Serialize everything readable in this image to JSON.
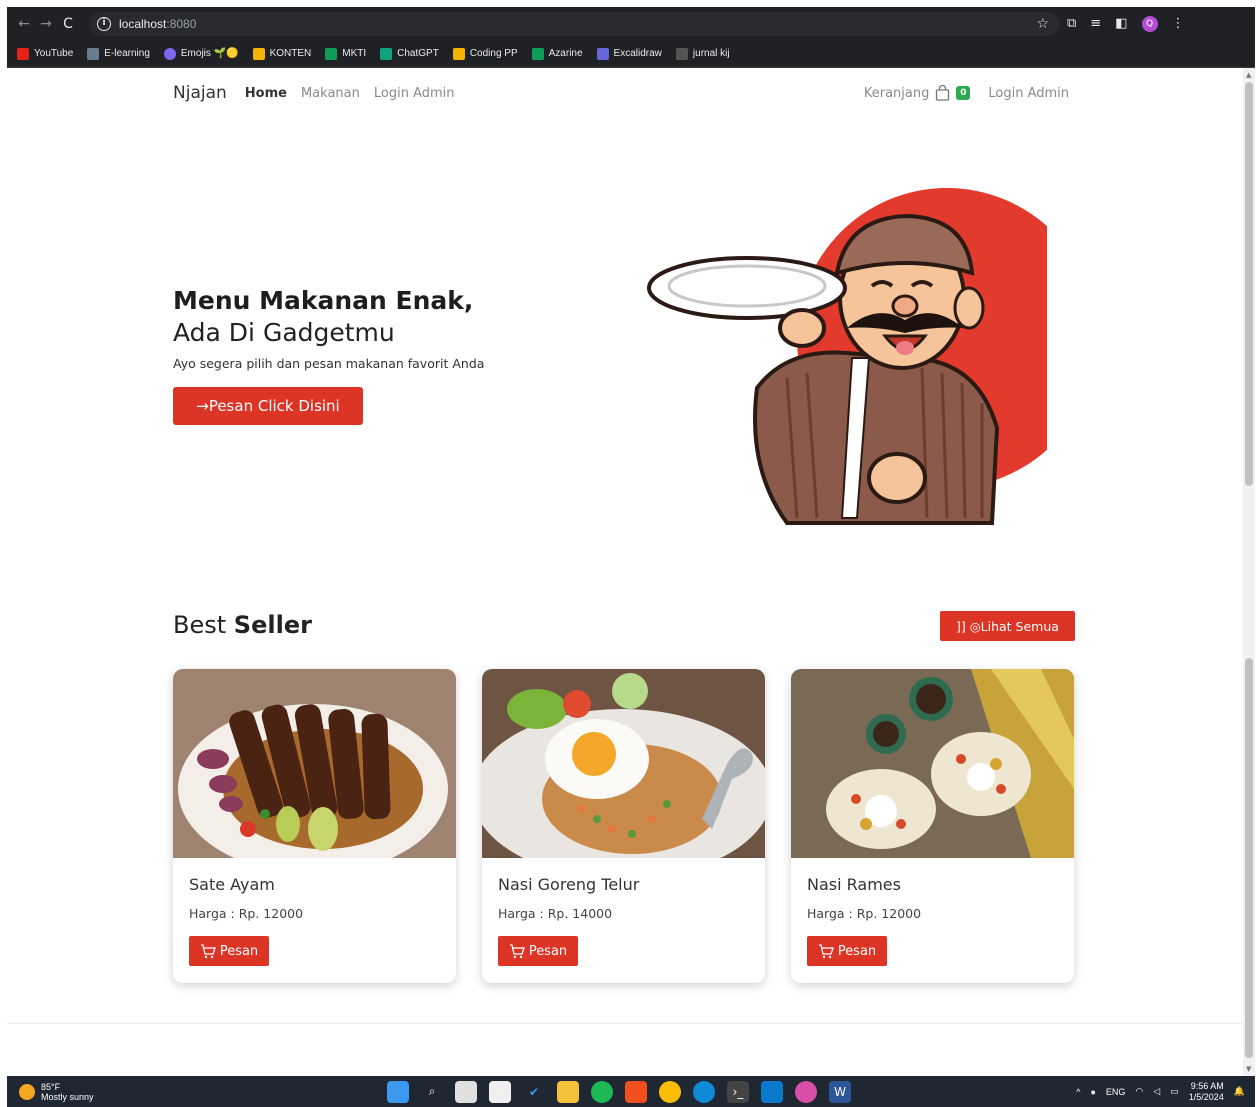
{
  "browser": {
    "url_host": "localhost",
    "url_port": ":8080",
    "bookmarks": [
      {
        "label": "YouTube",
        "color": "#e62117"
      },
      {
        "label": "E-learning",
        "color": "#6a7b8c"
      },
      {
        "label": "Emojis 🌱🟡",
        "color": "#7b68ee"
      },
      {
        "label": "KONTEN",
        "color": "#f4b400"
      },
      {
        "label": "MKTI",
        "color": "#0f9d58"
      },
      {
        "label": "ChatGPT",
        "color": "#10a37f"
      },
      {
        "label": "Coding PP",
        "color": "#f4b400"
      },
      {
        "label": "Azarine",
        "color": "#0f9d58"
      },
      {
        "label": "Excalidraw",
        "color": "#6965db"
      },
      {
        "label": "jurnal kij",
        "color": "#555555"
      }
    ],
    "profile_initial": "Q"
  },
  "nav": {
    "brand": "Njajan",
    "links": [
      "Home",
      "Makanan",
      "Login Admin"
    ],
    "cart_label": "Keranjang",
    "cart_count": "0",
    "login": "Login Admin"
  },
  "hero": {
    "title_bold": "Menu Makanan Enak,",
    "title_light": "Ada Di Gadgetmu",
    "subtitle": "Ayo segera pilih dan pesan makanan favorit Anda",
    "button": "→Pesan Click Disini"
  },
  "bestseller": {
    "title_light": "Best",
    "title_bold": "Seller",
    "see_all": "]] ◎Lihat Semua",
    "items": [
      {
        "name": "Sate Ayam",
        "price": "Harga : Rp. 12000",
        "button": "Pesan"
      },
      {
        "name": "Nasi Goreng Telur",
        "price": "Harga : Rp. 14000",
        "button": "Pesan"
      },
      {
        "name": "Nasi Rames",
        "price": "Harga : Rp. 12000",
        "button": "Pesan"
      }
    ]
  },
  "taskbar": {
    "temp": "85°F",
    "weather": "Mostly sunny",
    "lang": "ENG",
    "time": "9:56 AM",
    "date": "1/5/2024"
  },
  "colors": {
    "accent": "#dc3526",
    "badge": "#2fa84f"
  }
}
